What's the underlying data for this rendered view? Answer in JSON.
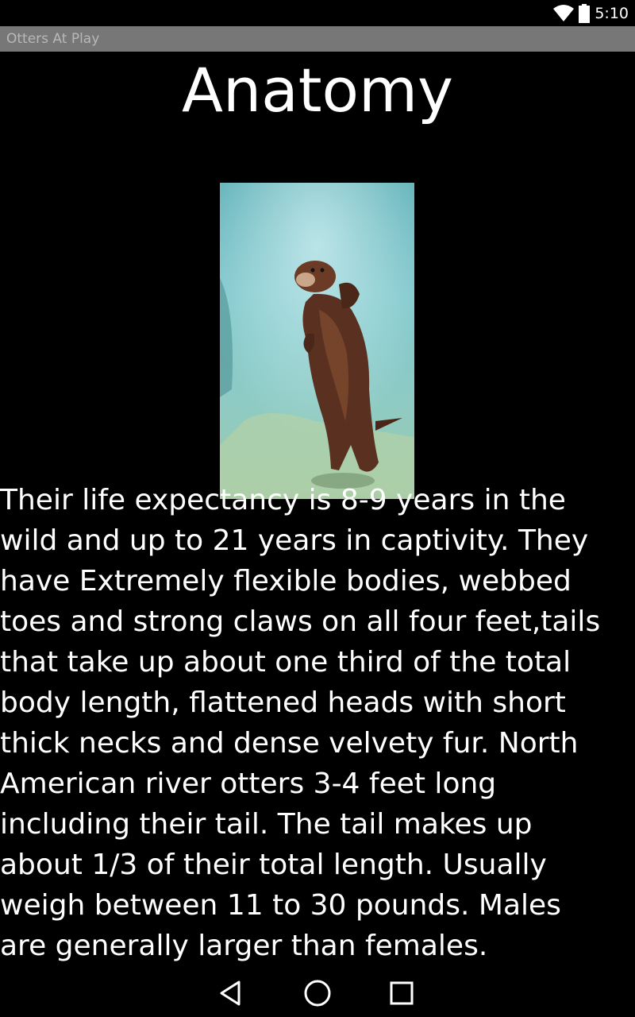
{
  "status_bar": {
    "time": "5:10"
  },
  "app": {
    "title": "Otters At Play"
  },
  "page": {
    "heading": "Anatomy",
    "body_text": "Their life expectancy is 8-9 years in the\nwild and up to 21 years in captivity. They\nhave Extremely flexible bodies, webbed\ntoes and strong claws on all four feet,tails\nthat take up about one third of the total\nbody length, flattened heads with short\nthick necks and dense velvety fur. North\nAmerican river otters 3-4 feet long\nincluding their tail. The tail makes up\nabout 1/3 of their total length. Usually\nweigh between 11 to 30 pounds. Males\nare generally larger than females."
  },
  "icons": {
    "status": [
      "wifi-icon",
      "battery-icon"
    ],
    "nav": [
      "back-icon",
      "home-icon",
      "recents-icon"
    ]
  },
  "colors": {
    "background": "#000000",
    "title_bar": "#777777",
    "text": "#ffffff"
  }
}
